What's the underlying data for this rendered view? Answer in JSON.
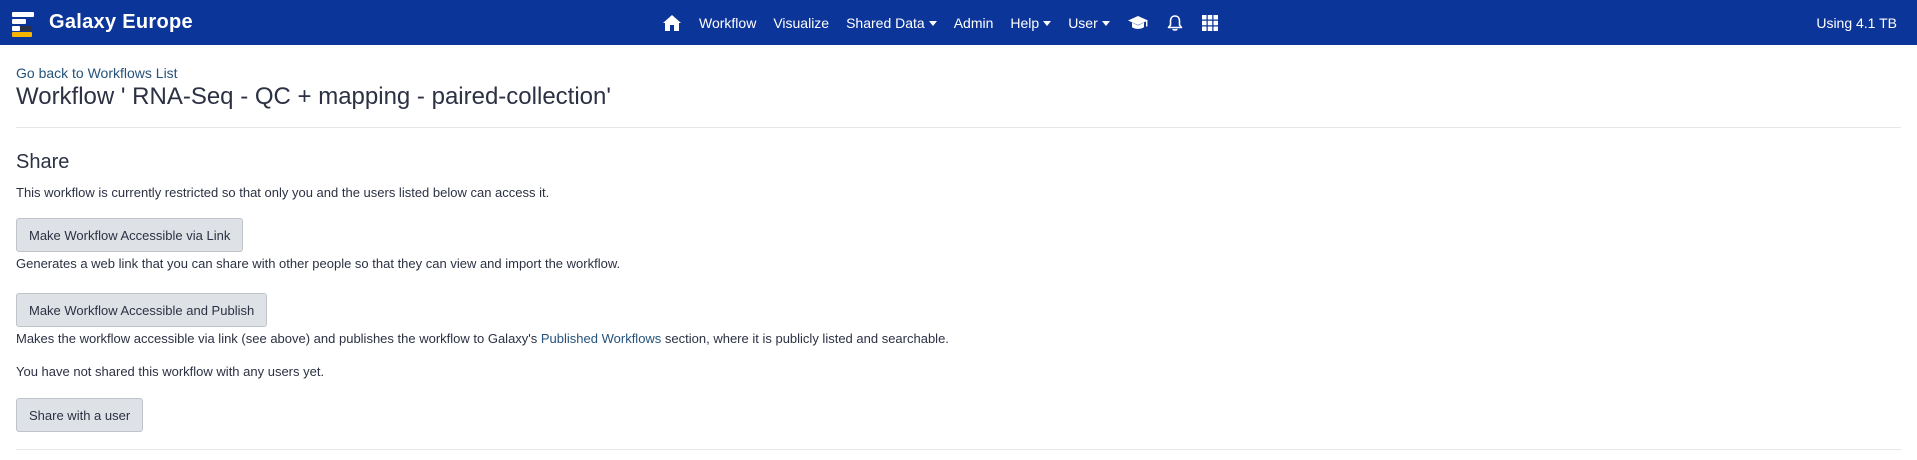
{
  "navbar": {
    "brand": "Galaxy Europe",
    "items": {
      "home_icon": "home-icon",
      "workflow": "Workflow",
      "visualize": "Visualize",
      "shared_data": "Shared Data",
      "admin": "Admin",
      "help": "Help",
      "user": "User",
      "training_icon": "graduation-cap-icon",
      "notifications_icon": "bell-icon",
      "apps_icon": "grid-icon"
    },
    "quota": "Using 4.1 TB",
    "colors": {
      "background": "#0c3599",
      "logo_bars": [
        "#ffffff",
        "#ffffff",
        "#2c3143",
        "#f5b400"
      ]
    }
  },
  "page": {
    "back_link": "Go back to Workflows List",
    "title": "Workflow ' RNA-Seq - QC + mapping - paired-collection'"
  },
  "share": {
    "heading": "Share",
    "status_text": "This workflow is currently restricted so that only you and the users listed below can access it.",
    "link_button": "Make Workflow Accessible via Link",
    "link_description": "Generates a web link that you can share with other people so that they can view and import the workflow.",
    "publish_button": "Make Workflow Accessible and Publish",
    "publish_description_before": "Makes the workflow accessible via link (see above) and publishes the workflow to Galaxy's ",
    "publish_description_link": "Published Workflows",
    "publish_description_after": " section, where it is publicly listed and searchable.",
    "users_status": "You have not shared this workflow with any users yet.",
    "share_user_button": "Share with a user"
  },
  "colors": {
    "link": "#25537b",
    "text": "#2c3143",
    "button_bg": "#dee2e6"
  }
}
